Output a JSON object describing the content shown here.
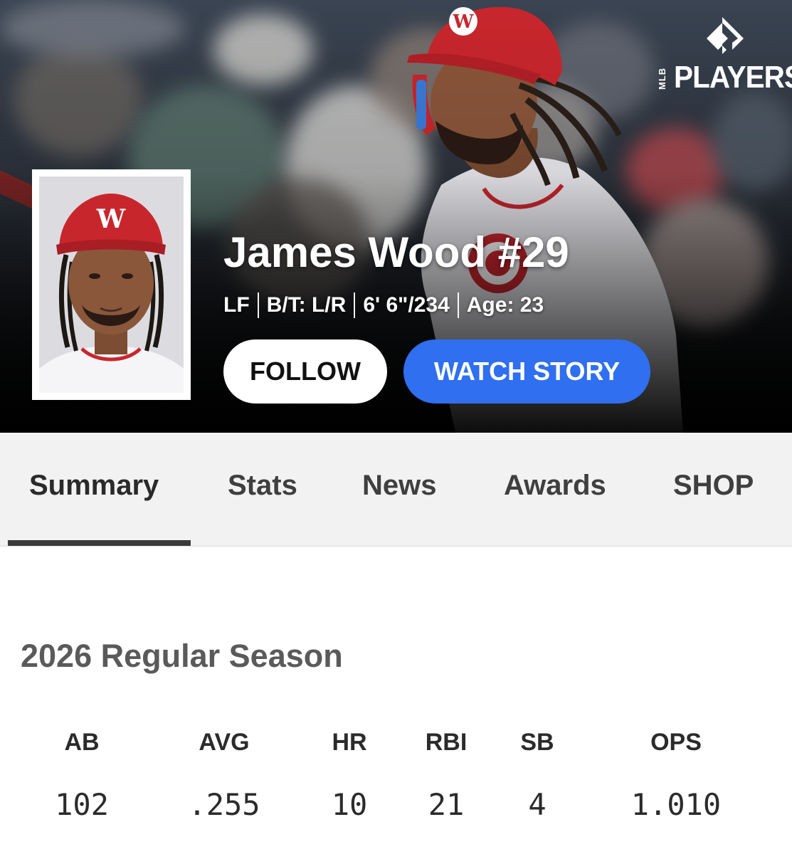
{
  "brand": {
    "logo_word": "PLAYERS",
    "logo_small": "MLB"
  },
  "player": {
    "name": "James Wood #29",
    "position": "LF",
    "bats_throws": "B/T: L/R",
    "height_weight": "6' 6\"/234",
    "age": "Age: 23"
  },
  "actions": {
    "follow_label": "FOLLOW",
    "watch_label": "WATCH STORY"
  },
  "tabs": [
    {
      "label": "Summary",
      "active": true
    },
    {
      "label": "Stats",
      "active": false
    },
    {
      "label": "News",
      "active": false
    },
    {
      "label": "Awards",
      "active": false
    },
    {
      "label": "SHOP",
      "active": false
    }
  ],
  "season": {
    "title": "2026 Regular Season",
    "stats": [
      {
        "label": "AB",
        "value": "102"
      },
      {
        "label": "AVG",
        "value": ".255"
      },
      {
        "label": "HR",
        "value": "10"
      },
      {
        "label": "RBI",
        "value": "21"
      },
      {
        "label": "SB",
        "value": "4"
      },
      {
        "label": "OPS",
        "value": "1.010"
      }
    ]
  },
  "colors": {
    "watch_button": "#2f6ff0",
    "helmet_red": "#c8262d",
    "tab_bar_bg": "#f2f2f2",
    "title_gray": "#5a5a5a"
  },
  "icons": {
    "logo": "mlb-players-diamond-icon",
    "cap_logo": "nationals-w-logo-icon"
  }
}
